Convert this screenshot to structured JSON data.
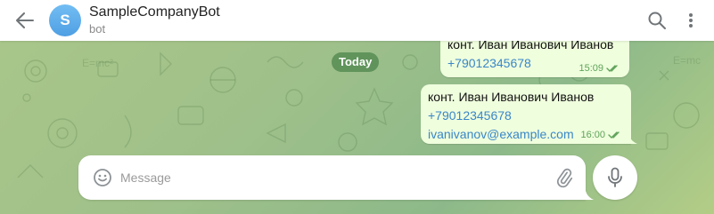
{
  "header": {
    "avatar_letter": "S",
    "title": "SampleCompanyBot",
    "subtitle": "bot",
    "back_icon": "arrow-left-icon",
    "search_icon": "search-icon",
    "menu_icon": "more-vertical-icon"
  },
  "chat": {
    "date_label": "Today",
    "messages": [
      {
        "lines": [
          "конт. Иван Иванович Иванов",
          "+79012345678"
        ],
        "time": "15:09",
        "status": "read"
      },
      {
        "lines": [
          "конт. Иван Иванович Иванов",
          "+79012345678",
          "ivanivanov@example.com"
        ],
        "time": "16:00",
        "status": "read"
      }
    ]
  },
  "composer": {
    "placeholder": "Message",
    "value": "",
    "emoji_icon": "emoji-icon",
    "attach_icon": "paperclip-icon",
    "mic_icon": "microphone-icon"
  },
  "colors": {
    "header_bg": "#ffffff",
    "avatar": "#5aa8ea",
    "outgoing_bubble": "#effedd",
    "link": "#3a86c8",
    "check": "#5fa35a",
    "date_pill": "#568c52"
  }
}
